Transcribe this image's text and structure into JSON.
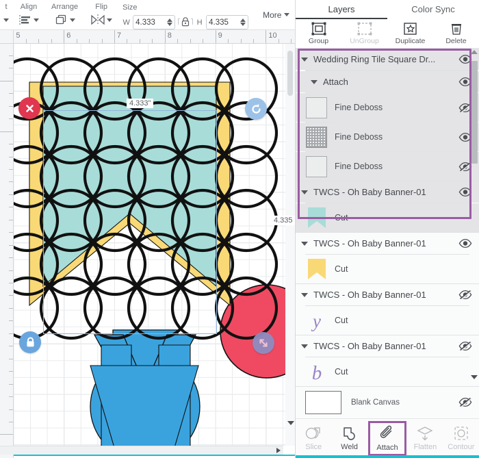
{
  "toolbar": {
    "cut_off_label": "t",
    "groups": [
      {
        "label": "Align",
        "icon": "align-icon"
      },
      {
        "label": "Arrange",
        "icon": "arrange-icon"
      },
      {
        "label": "Flip",
        "icon": "flip-icon"
      }
    ],
    "size": {
      "label": "Size",
      "width_letter": "W",
      "width_value": "4.333",
      "height_letter": "H",
      "height_value": "4.335",
      "lock_icon": "lock-closed-icon"
    },
    "more_label": "More",
    "more_icon": "chevron-down-icon"
  },
  "canvas": {
    "ruler_numbers": [
      "5",
      "6",
      "7",
      "8",
      "9",
      "10"
    ],
    "width_badge": "4.333\"",
    "height_badge": "4.335",
    "handles": {
      "delete": "delete-x-icon",
      "rotate": "rotate-icon",
      "lock": "lock-icon",
      "resize": "resize-diagonal-icon"
    },
    "colors": {
      "teal": "#a8dcd8",
      "yellow": "#f9d976",
      "blue": "#3aa3de",
      "red": "#ef4a62",
      "outline": "#111111",
      "selection": "#8fb4d9"
    }
  },
  "panel": {
    "tabs": [
      {
        "label": "Layers",
        "active": true
      },
      {
        "label": "Color Sync",
        "active": false
      }
    ],
    "actions": [
      {
        "label": "Group",
        "icon": "group-icon",
        "disabled": false
      },
      {
        "label": "UnGroup",
        "icon": "ungroup-icon",
        "disabled": true
      },
      {
        "label": "Duplicate",
        "icon": "duplicate-icon",
        "disabled": false
      },
      {
        "label": "Delete",
        "icon": "trash-icon",
        "disabled": false
      }
    ],
    "layers": [
      {
        "type": "group",
        "name": "Wedding Ring Tile Square Dr...",
        "visible": true,
        "selected": true,
        "indent": 0
      },
      {
        "type": "group",
        "name": "Attach",
        "visible": true,
        "selected": true,
        "indent": 1
      },
      {
        "type": "child",
        "name": "Fine Deboss",
        "thumb": "empty-square",
        "visible": false,
        "selected": true
      },
      {
        "type": "child",
        "name": "Fine Deboss",
        "thumb": "dotted-square",
        "visible": true,
        "selected": true
      },
      {
        "type": "child",
        "name": "Fine Deboss",
        "thumb": "empty-square",
        "visible": false,
        "selected": true
      },
      {
        "type": "group",
        "name": "TWCS - Oh Baby Banner-01",
        "visible": true,
        "selected": true,
        "indent": 0
      },
      {
        "type": "child",
        "name": "Cut",
        "thumb": "banner-teal",
        "visible": null,
        "selected": true
      },
      {
        "type": "group",
        "name": "TWCS - Oh Baby Banner-01",
        "visible": true,
        "selected": false,
        "indent": 0
      },
      {
        "type": "child",
        "name": "Cut",
        "thumb": "banner-yellow",
        "visible": null,
        "selected": false
      },
      {
        "type": "group",
        "name": "TWCS - Oh Baby Banner-01",
        "visible": false,
        "selected": false,
        "indent": 0
      },
      {
        "type": "child",
        "name": "Cut",
        "thumb": "letter-y",
        "visible": null,
        "selected": false
      },
      {
        "type": "group",
        "name": "TWCS - Oh Baby Banner-01",
        "visible": false,
        "selected": false,
        "indent": 0
      },
      {
        "type": "child",
        "name": "Cut",
        "thumb": "letter-b",
        "visible": null,
        "selected": false
      }
    ],
    "blank_canvas": {
      "label": "Blank Canvas",
      "visible": false
    },
    "operations": [
      {
        "label": "Slice",
        "icon": "slice-icon",
        "disabled": true,
        "highlight": false
      },
      {
        "label": "Weld",
        "icon": "weld-icon",
        "disabled": false,
        "highlight": false
      },
      {
        "label": "Attach",
        "icon": "paperclip-icon",
        "disabled": false,
        "highlight": true
      },
      {
        "label": "Flatten",
        "icon": "flatten-icon",
        "disabled": true,
        "highlight": false
      },
      {
        "label": "Contour",
        "icon": "contour-icon",
        "disabled": true,
        "highlight": false
      }
    ],
    "selection_color": "#9a5ba3"
  }
}
